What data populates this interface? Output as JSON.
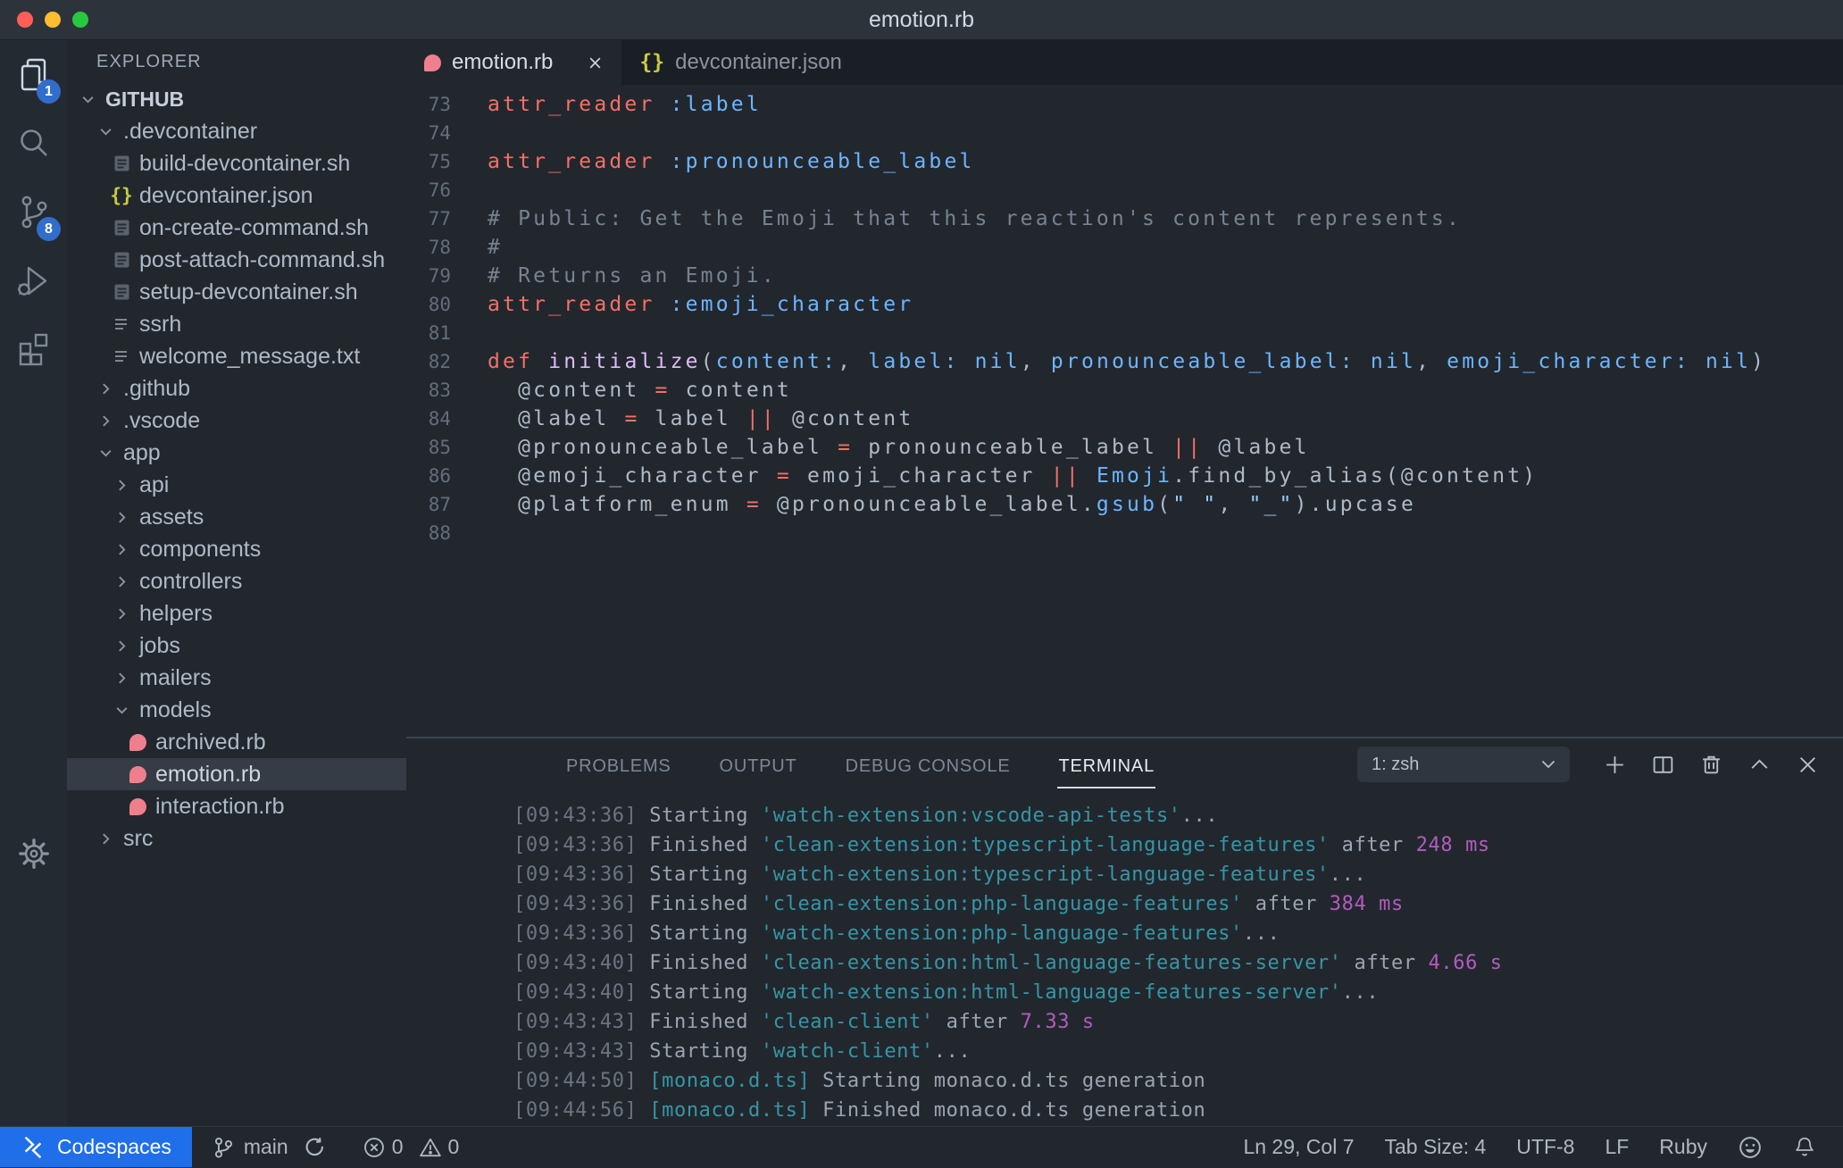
{
  "window": {
    "title": "emotion.rb"
  },
  "colors": {
    "badge_blue": "#316dca",
    "remote_blue": "#1f6feb",
    "ruby_pink": "#f07f8d",
    "json_yellow": "#cbcb41",
    "keyword_red": "#f47067",
    "symbol_blue": "#6cb6ff",
    "function_purple": "#dcbdfb",
    "terminal_task_teal": "#3596a5",
    "terminal_duration_magenta": "#b35bbd"
  },
  "activity_bar": {
    "items": [
      {
        "label": "Explorer",
        "icon": "files-icon",
        "badge": "1",
        "active": true
      },
      {
        "label": "Search",
        "icon": "search-icon"
      },
      {
        "label": "Source Control",
        "icon": "source-control-icon",
        "badge": "8"
      },
      {
        "label": "Run and Debug",
        "icon": "debug-icon"
      },
      {
        "label": "Extensions",
        "icon": "extensions-icon"
      }
    ],
    "bottom": [
      {
        "label": "Settings",
        "icon": "gear-icon"
      }
    ]
  },
  "sidebar": {
    "title": "EXPLORER",
    "tree": [
      {
        "label": "GITHUB",
        "level": 0,
        "kind": "folder",
        "state": "expanded",
        "bold": true
      },
      {
        "label": ".devcontainer",
        "level": 1,
        "kind": "folder",
        "state": "expanded"
      },
      {
        "label": "build-devcontainer.sh",
        "level": 2,
        "kind": "file",
        "icon": "shell"
      },
      {
        "label": "devcontainer.json",
        "level": 2,
        "kind": "file",
        "icon": "json"
      },
      {
        "label": "on-create-command.sh",
        "level": 2,
        "kind": "file",
        "icon": "shell"
      },
      {
        "label": "post-attach-command.sh",
        "level": 2,
        "kind": "file",
        "icon": "shell"
      },
      {
        "label": "setup-devcontainer.sh",
        "level": 2,
        "kind": "file",
        "icon": "shell"
      },
      {
        "label": "ssrh",
        "level": 2,
        "kind": "file",
        "icon": "list"
      },
      {
        "label": "welcome_message.txt",
        "level": 2,
        "kind": "file",
        "icon": "list"
      },
      {
        "label": ".github",
        "level": 1,
        "kind": "folder",
        "state": "collapsed"
      },
      {
        "label": ".vscode",
        "level": 1,
        "kind": "folder",
        "state": "collapsed"
      },
      {
        "label": "app",
        "level": 1,
        "kind": "folder",
        "state": "expanded"
      },
      {
        "label": "api",
        "level": 2,
        "kind": "folder",
        "state": "collapsed"
      },
      {
        "label": "assets",
        "level": 2,
        "kind": "folder",
        "state": "collapsed"
      },
      {
        "label": "components",
        "level": 2,
        "kind": "folder",
        "state": "collapsed"
      },
      {
        "label": "controllers",
        "level": 2,
        "kind": "folder",
        "state": "collapsed"
      },
      {
        "label": "helpers",
        "level": 2,
        "kind": "folder",
        "state": "collapsed"
      },
      {
        "label": "jobs",
        "level": 2,
        "kind": "folder",
        "state": "collapsed"
      },
      {
        "label": "mailers",
        "level": 2,
        "kind": "folder",
        "state": "collapsed"
      },
      {
        "label": "models",
        "level": 2,
        "kind": "folder",
        "state": "expanded"
      },
      {
        "label": "archived.rb",
        "level": 3,
        "kind": "file",
        "icon": "ruby"
      },
      {
        "label": "emotion.rb",
        "level": 3,
        "kind": "file",
        "icon": "ruby",
        "selected": true
      },
      {
        "label": "interaction.rb",
        "level": 3,
        "kind": "file",
        "icon": "ruby"
      },
      {
        "label": "src",
        "level": 1,
        "kind": "folder",
        "state": "collapsed"
      }
    ]
  },
  "editor": {
    "tabs": [
      {
        "label": "emotion.rb",
        "icon": "ruby",
        "active": true
      },
      {
        "label": "devcontainer.json",
        "icon": "json",
        "active": false
      }
    ],
    "code": [
      {
        "n": 73,
        "t": [
          [
            "kw",
            "attr_reader"
          ],
          [
            "fg",
            " "
          ],
          [
            "sym",
            ":label"
          ]
        ]
      },
      {
        "n": 74,
        "t": []
      },
      {
        "n": 75,
        "t": [
          [
            "kw",
            "attr_reader"
          ],
          [
            "fg",
            " "
          ],
          [
            "sym",
            ":pronounceable_label"
          ]
        ]
      },
      {
        "n": 76,
        "t": []
      },
      {
        "n": 77,
        "t": [
          [
            "cm",
            "# Public: Get the Emoji that this reaction's content represents."
          ]
        ]
      },
      {
        "n": 78,
        "t": [
          [
            "cm",
            "#"
          ]
        ]
      },
      {
        "n": 79,
        "t": [
          [
            "cm",
            "# Returns an Emoji."
          ]
        ]
      },
      {
        "n": 80,
        "t": [
          [
            "kw",
            "attr_reader"
          ],
          [
            "fg",
            " "
          ],
          [
            "sym",
            ":emoji_character"
          ]
        ]
      },
      {
        "n": 81,
        "t": []
      },
      {
        "n": 82,
        "t": [
          [
            "kw",
            "def"
          ],
          [
            "fg",
            " "
          ],
          [
            "fn",
            "initialize"
          ],
          [
            "fg",
            "("
          ],
          [
            "sym",
            "content:"
          ],
          [
            "fg",
            ", "
          ],
          [
            "sym",
            "label:"
          ],
          [
            "fg",
            " "
          ],
          [
            "sym",
            "nil"
          ],
          [
            "fg",
            ", "
          ],
          [
            "sym",
            "pronounceable_label:"
          ],
          [
            "fg",
            " "
          ],
          [
            "sym",
            "nil"
          ],
          [
            "fg",
            ", "
          ],
          [
            "sym",
            "emoji_character:"
          ],
          [
            "fg",
            " "
          ],
          [
            "sym",
            "nil"
          ],
          [
            "fg",
            ")"
          ]
        ]
      },
      {
        "n": 83,
        "t": [
          [
            "fg",
            "  @content "
          ],
          [
            "kw",
            "="
          ],
          [
            "fg",
            " content"
          ]
        ]
      },
      {
        "n": 84,
        "t": [
          [
            "fg",
            "  @label "
          ],
          [
            "kw",
            "="
          ],
          [
            "fg",
            " label "
          ],
          [
            "kw",
            "||"
          ],
          [
            "fg",
            " @content"
          ]
        ]
      },
      {
        "n": 85,
        "t": [
          [
            "fg",
            "  @pronounceable_label "
          ],
          [
            "kw",
            "="
          ],
          [
            "fg",
            " pronounceable_label "
          ],
          [
            "kw",
            "||"
          ],
          [
            "fg",
            " @label"
          ]
        ]
      },
      {
        "n": 86,
        "t": [
          [
            "fg",
            "  @emoji_character "
          ],
          [
            "kw",
            "="
          ],
          [
            "fg",
            " emoji_character "
          ],
          [
            "kw",
            "||"
          ],
          [
            "fg",
            " "
          ],
          [
            "sym",
            "Emoji"
          ],
          [
            "fg",
            ".find_by_alias(@content)"
          ]
        ]
      },
      {
        "n": 87,
        "t": [
          [
            "fg",
            "  @platform_enum "
          ],
          [
            "kw",
            "="
          ],
          [
            "fg",
            " @pronounceable_label."
          ],
          [
            "sym",
            "gsub"
          ],
          [
            "fg",
            "("
          ],
          [
            "str",
            "\" \""
          ],
          [
            "fg",
            ", "
          ],
          [
            "str",
            "\"_\""
          ],
          [
            "fg",
            ").upcase"
          ]
        ]
      },
      {
        "n": 88,
        "t": []
      }
    ]
  },
  "panel": {
    "tabs": [
      "PROBLEMS",
      "OUTPUT",
      "DEBUG CONSOLE",
      "TERMINAL"
    ],
    "active_tab": "TERMINAL",
    "shell_selector": "1: zsh",
    "terminal": [
      {
        "s": [
          [
            "ts",
            "[09:43:36] "
          ],
          [
            "fg",
            "Starting "
          ],
          [
            "task",
            "'watch-extension:vscode-api-tests'"
          ],
          [
            "fg",
            "..."
          ]
        ]
      },
      {
        "s": [
          [
            "ts",
            "[09:43:36] "
          ],
          [
            "fg",
            "Finished "
          ],
          [
            "task",
            "'clean-extension:typescript-language-features'"
          ],
          [
            "fg",
            " after "
          ],
          [
            "dur",
            "248 ms"
          ]
        ]
      },
      {
        "s": [
          [
            "ts",
            "[09:43:36] "
          ],
          [
            "fg",
            "Starting "
          ],
          [
            "task",
            "'watch-extension:typescript-language-features'"
          ],
          [
            "fg",
            "..."
          ]
        ]
      },
      {
        "s": [
          [
            "ts",
            "[09:43:36] "
          ],
          [
            "fg",
            "Finished "
          ],
          [
            "task",
            "'clean-extension:php-language-features'"
          ],
          [
            "fg",
            " after "
          ],
          [
            "dur",
            "384 ms"
          ]
        ]
      },
      {
        "s": [
          [
            "ts",
            "[09:43:36] "
          ],
          [
            "fg",
            "Starting "
          ],
          [
            "task",
            "'watch-extension:php-language-features'"
          ],
          [
            "fg",
            "..."
          ]
        ]
      },
      {
        "s": [
          [
            "ts",
            "[09:43:40] "
          ],
          [
            "fg",
            "Finished "
          ],
          [
            "task",
            "'clean-extension:html-language-features-server'"
          ],
          [
            "fg",
            " after "
          ],
          [
            "dur",
            "4.66 s"
          ]
        ]
      },
      {
        "s": [
          [
            "ts",
            "[09:43:40] "
          ],
          [
            "fg",
            "Starting "
          ],
          [
            "task",
            "'watch-extension:html-language-features-server'"
          ],
          [
            "fg",
            "..."
          ]
        ]
      },
      {
        "s": [
          [
            "ts",
            "[09:43:43] "
          ],
          [
            "fg",
            "Finished "
          ],
          [
            "task",
            "'clean-client'"
          ],
          [
            "fg",
            " after "
          ],
          [
            "dur",
            "7.33 s"
          ]
        ]
      },
      {
        "s": [
          [
            "ts",
            "[09:43:43] "
          ],
          [
            "fg",
            "Starting "
          ],
          [
            "task",
            "'watch-client'"
          ],
          [
            "fg",
            "..."
          ]
        ]
      },
      {
        "s": [
          [
            "ts",
            "[09:44:50] "
          ],
          [
            "task",
            "[monaco.d.ts]"
          ],
          [
            "fg",
            " Starting monaco.d.ts generation"
          ]
        ]
      },
      {
        "s": [
          [
            "ts",
            "[09:44:56] "
          ],
          [
            "task",
            "[monaco.d.ts]"
          ],
          [
            "fg",
            " Finished monaco.d.ts generation"
          ]
        ]
      }
    ]
  },
  "status_bar": {
    "codespaces": "Codespaces",
    "branch": "main",
    "errors": "0",
    "warnings": "0",
    "cursor": "Ln 29, Col 7",
    "tab_size": "Tab Size: 4",
    "encoding": "UTF-8",
    "eol": "LF",
    "language": "Ruby"
  }
}
